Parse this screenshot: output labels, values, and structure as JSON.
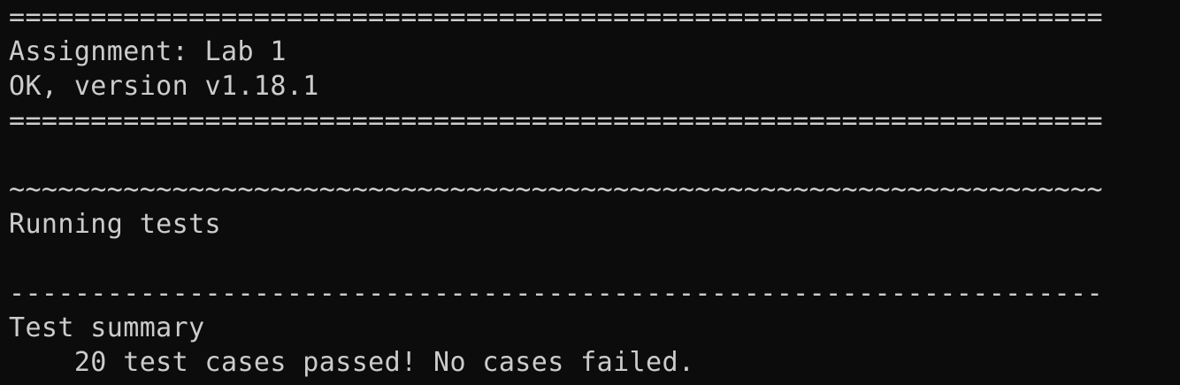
{
  "terminal": {
    "lines": [
      "===================================================================",
      "Assignment: Lab 1",
      "OK, version v1.18.1",
      "===================================================================",
      "",
      "~~~~~~~~~~~~~~~~~~~~~~~~~~~~~~~~~~~~~~~~~~~~~~~~~~~~~~~~~~~~~~~~~~~",
      "Running tests",
      "",
      "-------------------------------------------------------------------",
      "Test summary",
      "    20 test cases passed! No cases failed."
    ],
    "colors": {
      "background": "#0c0c0c",
      "foreground": "#cccccc"
    }
  }
}
